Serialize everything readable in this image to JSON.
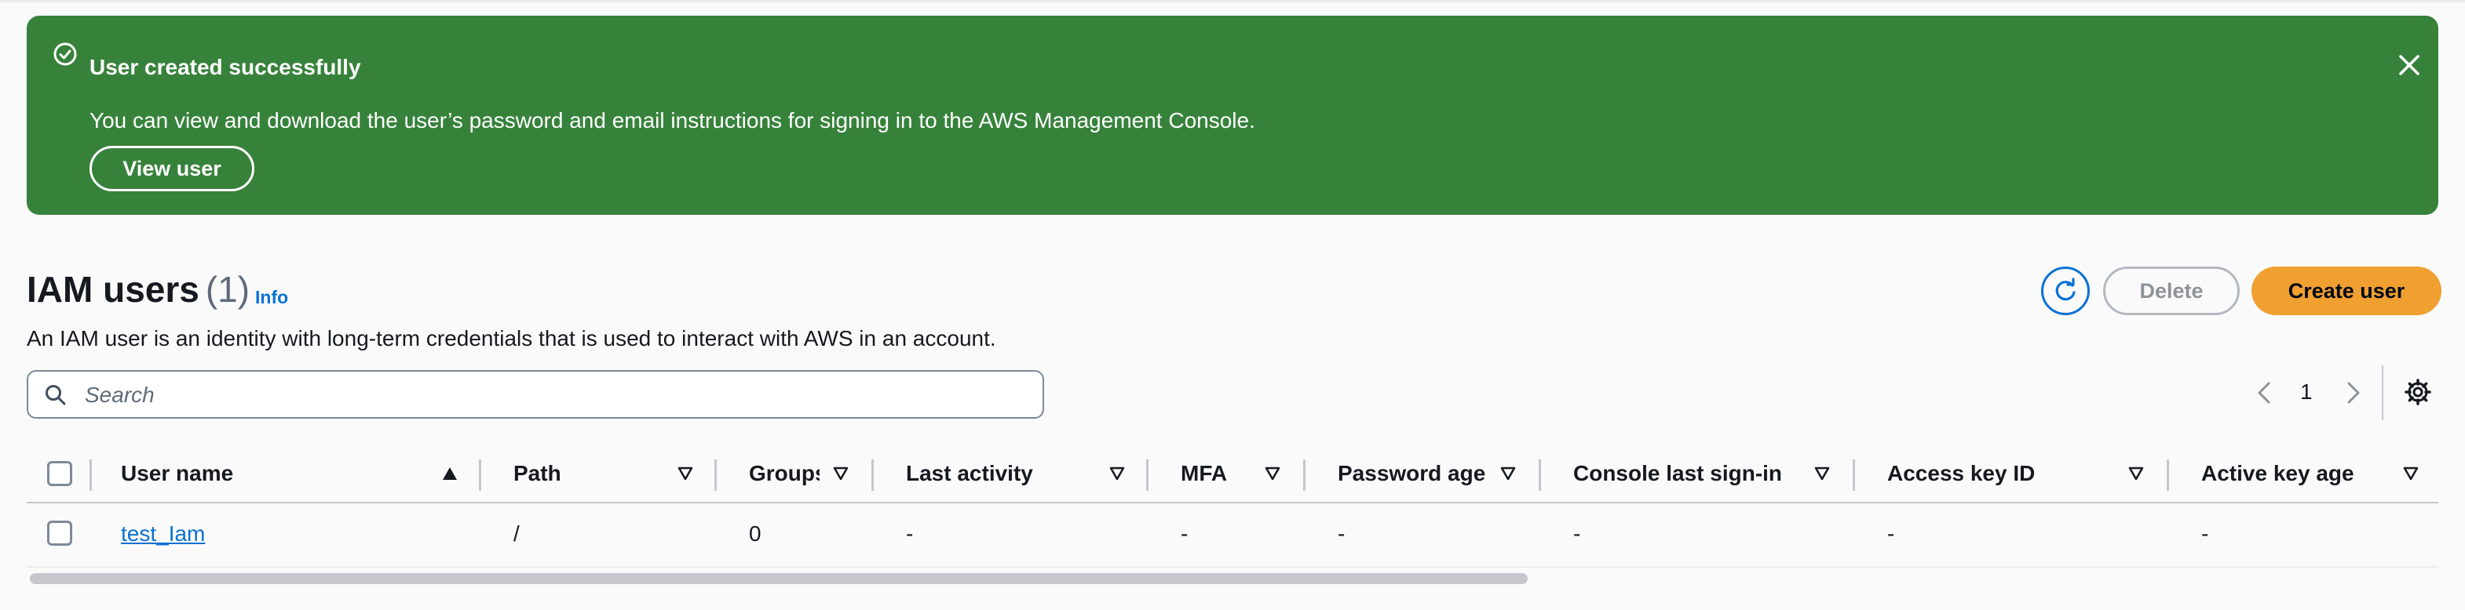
{
  "flash": {
    "title": "User created successfully",
    "message": "You can view and download the user’s password and email instructions for signing in to the AWS Management Console.",
    "view_button": "View user",
    "color": "#37823b"
  },
  "header": {
    "title": "IAM users",
    "count": "(1)",
    "info_link": "Info",
    "description": "An IAM user is an identity with long-term credentials that is used to interact with AWS in an account.",
    "delete_button": "Delete",
    "create_button": "Create user",
    "accent_color": "#0972d3",
    "primary_color": "#f0a030"
  },
  "search": {
    "placeholder": "Search",
    "value": ""
  },
  "pagination": {
    "current_page": "1"
  },
  "table": {
    "columns": [
      {
        "label": "User name",
        "sort": "ascending"
      },
      {
        "label": "Path",
        "sort": "none"
      },
      {
        "label": "Groups",
        "sort": "none"
      },
      {
        "label": "Last activity",
        "sort": "none"
      },
      {
        "label": "MFA",
        "sort": "none"
      },
      {
        "label": "Password age",
        "sort": "none"
      },
      {
        "label": "Console last sign-in",
        "sort": "none"
      },
      {
        "label": "Access key ID",
        "sort": "none"
      },
      {
        "label": "Active key age",
        "sort": "none"
      }
    ],
    "rows": [
      {
        "user_name": "test_Iam",
        "path": "/",
        "groups": "0",
        "last_activity": "-",
        "mfa": "-",
        "password_age": "-",
        "console_last_sign_in": "-",
        "access_key_id": "-",
        "active_key_age": "-"
      }
    ]
  }
}
